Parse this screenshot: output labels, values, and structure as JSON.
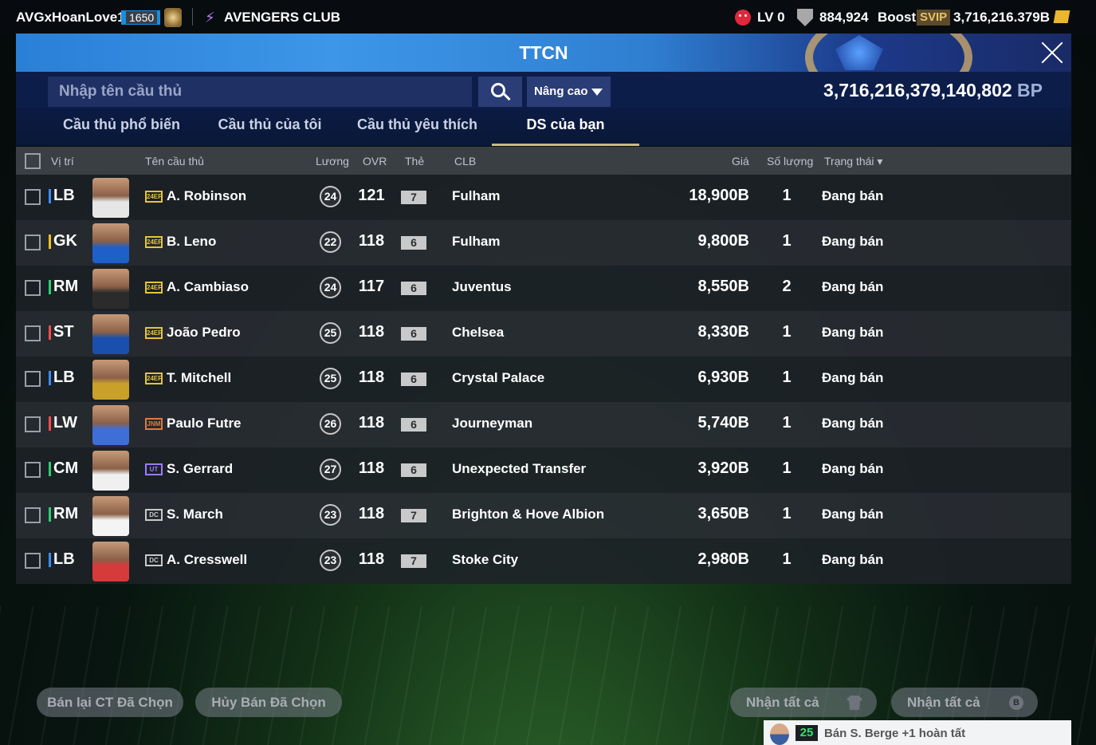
{
  "topbar": {
    "username": "AVGxHoanLove18",
    "badge_label": "",
    "level_badge": "1650",
    "club_name": "AVENGERS CLUB",
    "lv": "LV 0",
    "coins": "884,924",
    "boost_label": "Boost",
    "svip_label": "SVIP",
    "bp_short": "3,716,216.379B"
  },
  "header": {
    "title": "TTCN"
  },
  "search": {
    "placeholder": "Nhập tên cầu thủ",
    "advanced_label": "Nâng cao",
    "bp_value": "3,716,216,379,140,802",
    "bp_unit": "BP"
  },
  "tabs": [
    {
      "label": "Cầu thủ phổ biến",
      "active": false
    },
    {
      "label": "Cầu thủ của tôi",
      "active": false
    },
    {
      "label": "Cầu thủ yêu thích",
      "active": false
    },
    {
      "label": "DS của bạn",
      "active": true
    }
  ],
  "columns": {
    "position": "Vị trí",
    "name": "Tên cầu thủ",
    "wage": "Lương",
    "ovr": "OVR",
    "grade": "Thẻ",
    "club": "CLB",
    "price": "Giá",
    "qty": "Số lượng",
    "status": "Trạng thái"
  },
  "rows": [
    {
      "pos": "LB",
      "pos_color": "#3b8cff",
      "season": "24EP",
      "season_color": "#e8c23a",
      "shirt": "#e6e6e6",
      "name": "A. Robinson",
      "wage": "24",
      "ovr": "121",
      "grade": "7",
      "club": "Fulham",
      "price": "18,900B",
      "qty": "1",
      "status": "Đang bán"
    },
    {
      "pos": "GK",
      "pos_color": "#f0c020",
      "season": "24EP",
      "season_color": "#e8c23a",
      "shirt": "#1f5fc8",
      "name": "B. Leno",
      "wage": "22",
      "ovr": "118",
      "grade": "6",
      "club": "Fulham",
      "price": "9,800B",
      "qty": "1",
      "status": "Đang bán"
    },
    {
      "pos": "RM",
      "pos_color": "#2ecc71",
      "season": "24EP",
      "season_color": "#e8c23a",
      "shirt": "#2b2b2b",
      "name": "A. Cambiaso",
      "wage": "24",
      "ovr": "117",
      "grade": "6",
      "club": "Juventus",
      "price": "8,550B",
      "qty": "2",
      "status": "Đang bán"
    },
    {
      "pos": "ST",
      "pos_color": "#ff4a4a",
      "season": "24EP",
      "season_color": "#e8c23a",
      "shirt": "#1a4fae",
      "name": "João Pedro",
      "wage": "25",
      "ovr": "118",
      "grade": "6",
      "club": "Chelsea",
      "price": "8,330B",
      "qty": "1",
      "status": "Đang bán"
    },
    {
      "pos": "LB",
      "pos_color": "#3b8cff",
      "season": "24EP",
      "season_color": "#e8c23a",
      "shirt": "#c9a02a",
      "name": "T. Mitchell",
      "wage": "25",
      "ovr": "118",
      "grade": "6",
      "club": "Crystal Palace",
      "price": "6,930B",
      "qty": "1",
      "status": "Đang bán"
    },
    {
      "pos": "LW",
      "pos_color": "#ff4a4a",
      "season": "JNM",
      "season_color": "#e07a3a",
      "shirt": "#3f6fd6",
      "name": "Paulo Futre",
      "wage": "26",
      "ovr": "118",
      "grade": "6",
      "club": "Journeyman",
      "price": "5,740B",
      "qty": "1",
      "status": "Đang bán"
    },
    {
      "pos": "CM",
      "pos_color": "#2ecc71",
      "season": "UT",
      "season_color": "#9b7bff",
      "shirt": "#f0f0f0",
      "name": "S. Gerrard",
      "wage": "27",
      "ovr": "118",
      "grade": "6",
      "club": "Unexpected Transfer",
      "price": "3,920B",
      "qty": "1",
      "status": "Đang bán"
    },
    {
      "pos": "RM",
      "pos_color": "#2ecc71",
      "season": "DC",
      "season_color": "#c9c9c9",
      "shirt": "#f4f4f4",
      "name": "S. March",
      "wage": "23",
      "ovr": "118",
      "grade": "7",
      "club": "Brighton & Hove Albion",
      "price": "3,650B",
      "qty": "1",
      "status": "Đang bán"
    },
    {
      "pos": "LB",
      "pos_color": "#3b8cff",
      "season": "DC",
      "season_color": "#c9c9c9",
      "shirt": "#d63a3a",
      "name": "A. Cresswell",
      "wage": "23",
      "ovr": "118",
      "grade": "7",
      "club": "Stoke City",
      "price": "2,980B",
      "qty": "1",
      "status": "Đang bán"
    }
  ],
  "buttons": {
    "resell": "Bán lại CT Đã Chọn",
    "cancel": "Hủy Bán Đã Chọn",
    "claim_all_1": "Nhận tất cả",
    "claim_all_2": "Nhận tất cả",
    "claim_icon_2": "B"
  },
  "toast": {
    "badge": "25",
    "text": "Bán S. Berge +1 hoàn tất"
  }
}
